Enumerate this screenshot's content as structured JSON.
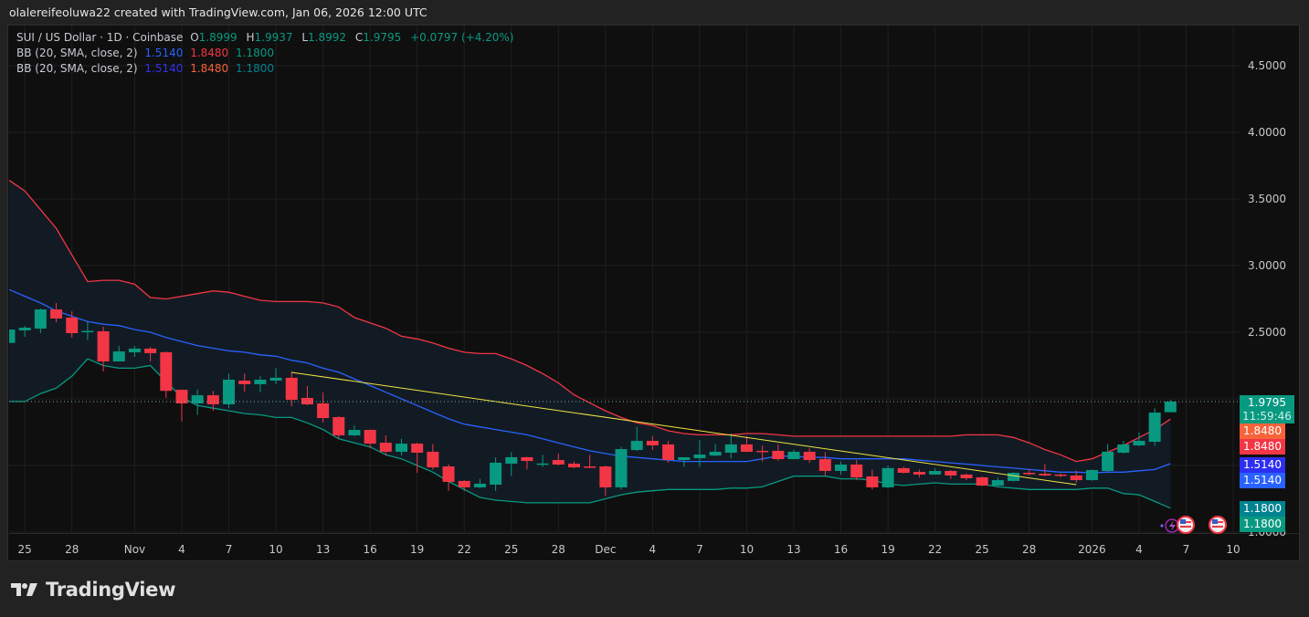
{
  "attribution": "olalereifeoluwa22 created with TradingView.com, Jan 06, 2026 12:00 UTC",
  "legend": {
    "symbol": "SUI / US Dollar · 1D · Coinbase",
    "o_label": "O",
    "o": "1.8999",
    "h_label": "H",
    "h": "1.9937",
    "l_label": "L",
    "l": "1.8992",
    "c_label": "C",
    "c": "1.9795",
    "change": "+0.0797 (+4.20%)",
    "indicators": [
      {
        "name": "BB (20, SMA, close, 2)",
        "basis": "1.5140",
        "upper": "1.8480",
        "lower": "1.1800",
        "colors": {
          "basis": "#2962ff",
          "upper": "#f23645",
          "lower": "#089981"
        }
      },
      {
        "name": "BB (20, SMA, close, 2)",
        "basis": "1.5140",
        "upper": "1.8480",
        "lower": "1.1800",
        "colors": {
          "basis": "#3030f0",
          "upper": "#f7633a",
          "lower": "#00838f"
        }
      }
    ]
  },
  "price_badges": {
    "last": "1.9795",
    "countdown": "11:59:46",
    "upper1": "1.8480",
    "upper2": "1.8480",
    "basis1": "1.5140",
    "basis2": "1.5140",
    "lower1": "1.1800",
    "lower2": "1.1800"
  },
  "logo": {
    "text": "TradingView"
  },
  "chart_data": {
    "type": "candlestick",
    "symbol": "SUI / US Dollar",
    "interval": "1D",
    "ylim": [
      1.0,
      4.8
    ],
    "y_ticks": [
      "4.5000",
      "4.0000",
      "3.5000",
      "3.0000",
      "2.5000",
      "1.0000"
    ],
    "y_grid": [
      1.0,
      1.5,
      2.0,
      2.5,
      3.0,
      3.5,
      4.0,
      4.5
    ],
    "grid": true,
    "x_ticks": [
      {
        "label": "25",
        "date": "2025-10-25"
      },
      {
        "label": "28",
        "date": "2025-10-28"
      },
      {
        "label": "Nov",
        "date": "2025-11-01"
      },
      {
        "label": "4",
        "date": "2025-11-04"
      },
      {
        "label": "7",
        "date": "2025-11-07"
      },
      {
        "label": "10",
        "date": "2025-11-10"
      },
      {
        "label": "13",
        "date": "2025-11-13"
      },
      {
        "label": "16",
        "date": "2025-11-16"
      },
      {
        "label": "19",
        "date": "2025-11-19"
      },
      {
        "label": "22",
        "date": "2025-11-22"
      },
      {
        "label": "25",
        "date": "2025-11-25"
      },
      {
        "label": "28",
        "date": "2025-11-28"
      },
      {
        "label": "Dec",
        "date": "2025-12-01"
      },
      {
        "label": "4",
        "date": "2025-12-04"
      },
      {
        "label": "7",
        "date": "2025-12-07"
      },
      {
        "label": "10",
        "date": "2025-12-10"
      },
      {
        "label": "13",
        "date": "2025-12-13"
      },
      {
        "label": "16",
        "date": "2025-12-16"
      },
      {
        "label": "19",
        "date": "2025-12-19"
      },
      {
        "label": "22",
        "date": "2025-12-22"
      },
      {
        "label": "25",
        "date": "2025-12-25"
      },
      {
        "label": "28",
        "date": "2025-12-28"
      },
      {
        "label": "2026",
        "date": "2026-01-01"
      },
      {
        "label": "4",
        "date": "2026-01-04"
      },
      {
        "label": "7",
        "date": "2026-01-07"
      },
      {
        "label": "10",
        "date": "2026-01-10"
      }
    ],
    "start_date": "2025-10-24",
    "candles": [
      [
        2.42,
        2.52,
        2.42,
        2.52
      ],
      [
        2.514,
        2.548,
        2.466,
        2.534
      ],
      [
        2.527,
        2.678,
        2.493,
        2.671
      ],
      [
        2.671,
        2.719,
        2.575,
        2.603
      ],
      [
        2.61,
        2.658,
        2.459,
        2.493
      ],
      [
        2.5,
        2.58,
        2.44,
        2.51
      ],
      [
        2.507,
        2.541,
        2.205,
        2.281
      ],
      [
        2.281,
        2.397,
        2.28,
        2.356
      ],
      [
        2.349,
        2.397,
        2.315,
        2.377
      ],
      [
        2.377,
        2.39,
        2.28,
        2.343
      ],
      [
        2.35,
        2.356,
        2.007,
        2.06
      ],
      [
        2.068,
        2.07,
        1.83,
        1.966
      ],
      [
        1.966,
        2.07,
        1.88,
        2.027
      ],
      [
        2.027,
        2.06,
        1.91,
        1.959
      ],
      [
        1.959,
        2.19,
        1.93,
        2.144
      ],
      [
        2.137,
        2.19,
        2.055,
        2.11
      ],
      [
        2.11,
        2.17,
        2.05,
        2.144
      ],
      [
        2.137,
        2.23,
        2.11,
        2.158
      ],
      [
        2.158,
        2.205,
        1.945,
        1.993
      ],
      [
        2.007,
        2.095,
        1.952,
        1.959
      ],
      [
        1.966,
        2.048,
        1.822,
        1.856
      ],
      [
        1.863,
        1.87,
        1.7,
        1.726
      ],
      [
        1.726,
        1.8,
        1.72,
        1.767
      ],
      [
        1.767,
        1.77,
        1.63,
        1.664
      ],
      [
        1.671,
        1.726,
        1.575,
        1.603
      ],
      [
        1.603,
        1.7,
        1.575,
        1.664
      ],
      [
        1.664,
        1.67,
        1.445,
        1.596
      ],
      [
        1.603,
        1.66,
        1.47,
        1.486
      ],
      [
        1.493,
        1.51,
        1.31,
        1.377
      ],
      [
        1.384,
        1.39,
        1.31,
        1.336
      ],
      [
        1.336,
        1.4,
        1.33,
        1.363
      ],
      [
        1.356,
        1.56,
        1.31,
        1.521
      ],
      [
        1.514,
        1.6,
        1.42,
        1.562
      ],
      [
        1.562,
        1.565,
        1.47,
        1.534
      ],
      [
        1.51,
        1.58,
        1.49,
        1.515
      ],
      [
        1.541,
        1.59,
        1.5,
        1.507
      ],
      [
        1.514,
        1.53,
        1.48,
        1.486
      ],
      [
        1.493,
        1.58,
        1.48,
        1.486
      ],
      [
        1.493,
        1.5,
        1.27,
        1.336
      ],
      [
        1.336,
        1.64,
        1.32,
        1.623
      ],
      [
        1.616,
        1.79,
        1.61,
        1.685
      ],
      [
        1.685,
        1.72,
        1.616,
        1.651
      ],
      [
        1.658,
        1.685,
        1.52,
        1.541
      ],
      [
        1.541,
        1.56,
        1.49,
        1.562
      ],
      [
        1.555,
        1.69,
        1.49,
        1.582
      ],
      [
        1.575,
        1.66,
        1.57,
        1.603
      ],
      [
        1.596,
        1.74,
        1.555,
        1.658
      ],
      [
        1.658,
        1.72,
        1.6,
        1.603
      ],
      [
        1.61,
        1.65,
        1.53,
        1.607
      ],
      [
        1.61,
        1.66,
        1.535,
        1.548
      ],
      [
        1.548,
        1.62,
        1.545,
        1.603
      ],
      [
        1.603,
        1.63,
        1.52,
        1.541
      ],
      [
        1.548,
        1.6,
        1.425,
        1.459
      ],
      [
        1.459,
        1.53,
        1.43,
        1.507
      ],
      [
        1.507,
        1.54,
        1.39,
        1.411
      ],
      [
        1.418,
        1.47,
        1.32,
        1.336
      ],
      [
        1.336,
        1.5,
        1.33,
        1.48
      ],
      [
        1.48,
        1.49,
        1.44,
        1.445
      ],
      [
        1.452,
        1.47,
        1.41,
        1.432
      ],
      [
        1.432,
        1.48,
        1.43,
        1.459
      ],
      [
        1.459,
        1.465,
        1.4,
        1.425
      ],
      [
        1.432,
        1.44,
        1.39,
        1.404
      ],
      [
        1.411,
        1.42,
        1.345,
        1.349
      ],
      [
        1.349,
        1.41,
        1.345,
        1.39
      ],
      [
        1.384,
        1.45,
        1.38,
        1.445
      ],
      [
        1.445,
        1.47,
        1.425,
        1.438
      ],
      [
        1.438,
        1.51,
        1.42,
        1.425
      ],
      [
        1.432,
        1.44,
        1.41,
        1.425
      ],
      [
        1.425,
        1.46,
        1.37,
        1.39
      ],
      [
        1.39,
        1.47,
        1.385,
        1.466
      ],
      [
        1.459,
        1.66,
        1.45,
        1.603
      ],
      [
        1.596,
        1.685,
        1.59,
        1.658
      ],
      [
        1.651,
        1.75,
        1.645,
        1.685
      ],
      [
        1.678,
        1.93,
        1.65,
        1.897
      ],
      [
        1.8999,
        1.9937,
        1.8992,
        1.9795
      ]
    ],
    "bb_upper": [
      3.64,
      3.56,
      3.42,
      3.28,
      3.08,
      2.88,
      2.89,
      2.89,
      2.86,
      2.76,
      2.75,
      2.77,
      2.79,
      2.81,
      2.8,
      2.77,
      2.74,
      2.73,
      2.73,
      2.73,
      2.72,
      2.69,
      2.61,
      2.57,
      2.53,
      2.47,
      2.45,
      2.42,
      2.38,
      2.35,
      2.34,
      2.34,
      2.3,
      2.25,
      2.19,
      2.12,
      2.03,
      1.97,
      1.91,
      1.86,
      1.82,
      1.8,
      1.76,
      1.74,
      1.73,
      1.73,
      1.73,
      1.74,
      1.74,
      1.73,
      1.72,
      1.72,
      1.72,
      1.72,
      1.72,
      1.72,
      1.72,
      1.72,
      1.72,
      1.72,
      1.72,
      1.73,
      1.73,
      1.73,
      1.71,
      1.67,
      1.62,
      1.58,
      1.53,
      1.55,
      1.6,
      1.65,
      1.71,
      1.77,
      1.848
    ],
    "bb_basis": [
      2.82,
      2.77,
      2.72,
      2.66,
      2.62,
      2.58,
      2.56,
      2.55,
      2.52,
      2.5,
      2.46,
      2.43,
      2.4,
      2.38,
      2.36,
      2.35,
      2.33,
      2.32,
      2.29,
      2.27,
      2.23,
      2.2,
      2.15,
      2.1,
      2.05,
      2.0,
      1.95,
      1.9,
      1.85,
      1.81,
      1.79,
      1.77,
      1.75,
      1.73,
      1.7,
      1.67,
      1.64,
      1.61,
      1.59,
      1.57,
      1.56,
      1.55,
      1.54,
      1.53,
      1.53,
      1.53,
      1.53,
      1.53,
      1.55,
      1.57,
      1.57,
      1.56,
      1.56,
      1.55,
      1.55,
      1.55,
      1.55,
      1.55,
      1.54,
      1.53,
      1.52,
      1.51,
      1.5,
      1.49,
      1.48,
      1.47,
      1.46,
      1.45,
      1.45,
      1.445,
      1.45,
      1.45,
      1.46,
      1.47,
      1.514
    ],
    "bb_lower": [
      1.98,
      1.98,
      2.04,
      2.08,
      2.17,
      2.3,
      2.25,
      2.23,
      2.23,
      2.25,
      2.13,
      2.01,
      1.95,
      1.93,
      1.91,
      1.89,
      1.88,
      1.86,
      1.86,
      1.82,
      1.77,
      1.7,
      1.67,
      1.64,
      1.58,
      1.55,
      1.5,
      1.45,
      1.38,
      1.32,
      1.26,
      1.24,
      1.23,
      1.22,
      1.22,
      1.22,
      1.22,
      1.22,
      1.25,
      1.28,
      1.3,
      1.31,
      1.32,
      1.32,
      1.32,
      1.32,
      1.33,
      1.33,
      1.34,
      1.38,
      1.42,
      1.42,
      1.42,
      1.4,
      1.4,
      1.39,
      1.36,
      1.35,
      1.36,
      1.37,
      1.36,
      1.36,
      1.36,
      1.34,
      1.33,
      1.32,
      1.32,
      1.32,
      1.32,
      1.33,
      1.33,
      1.29,
      1.28,
      1.23,
      1.18
    ],
    "trendline": {
      "from": {
        "date": "2025-11-11",
        "price": 2.199
      },
      "to": {
        "date": "2025-12-31",
        "price": 1.356
      },
      "color": "#f0e442"
    },
    "last_price_line": 1.9795,
    "colors": {
      "up": "#089981",
      "down": "#f23645",
      "basis": "#2962ff",
      "upper": "#f23645",
      "lower": "#089981",
      "fill": "#121b24"
    },
    "events": [
      "lightning-icon",
      "us-flag-icon",
      "us-flag-icon"
    ]
  }
}
